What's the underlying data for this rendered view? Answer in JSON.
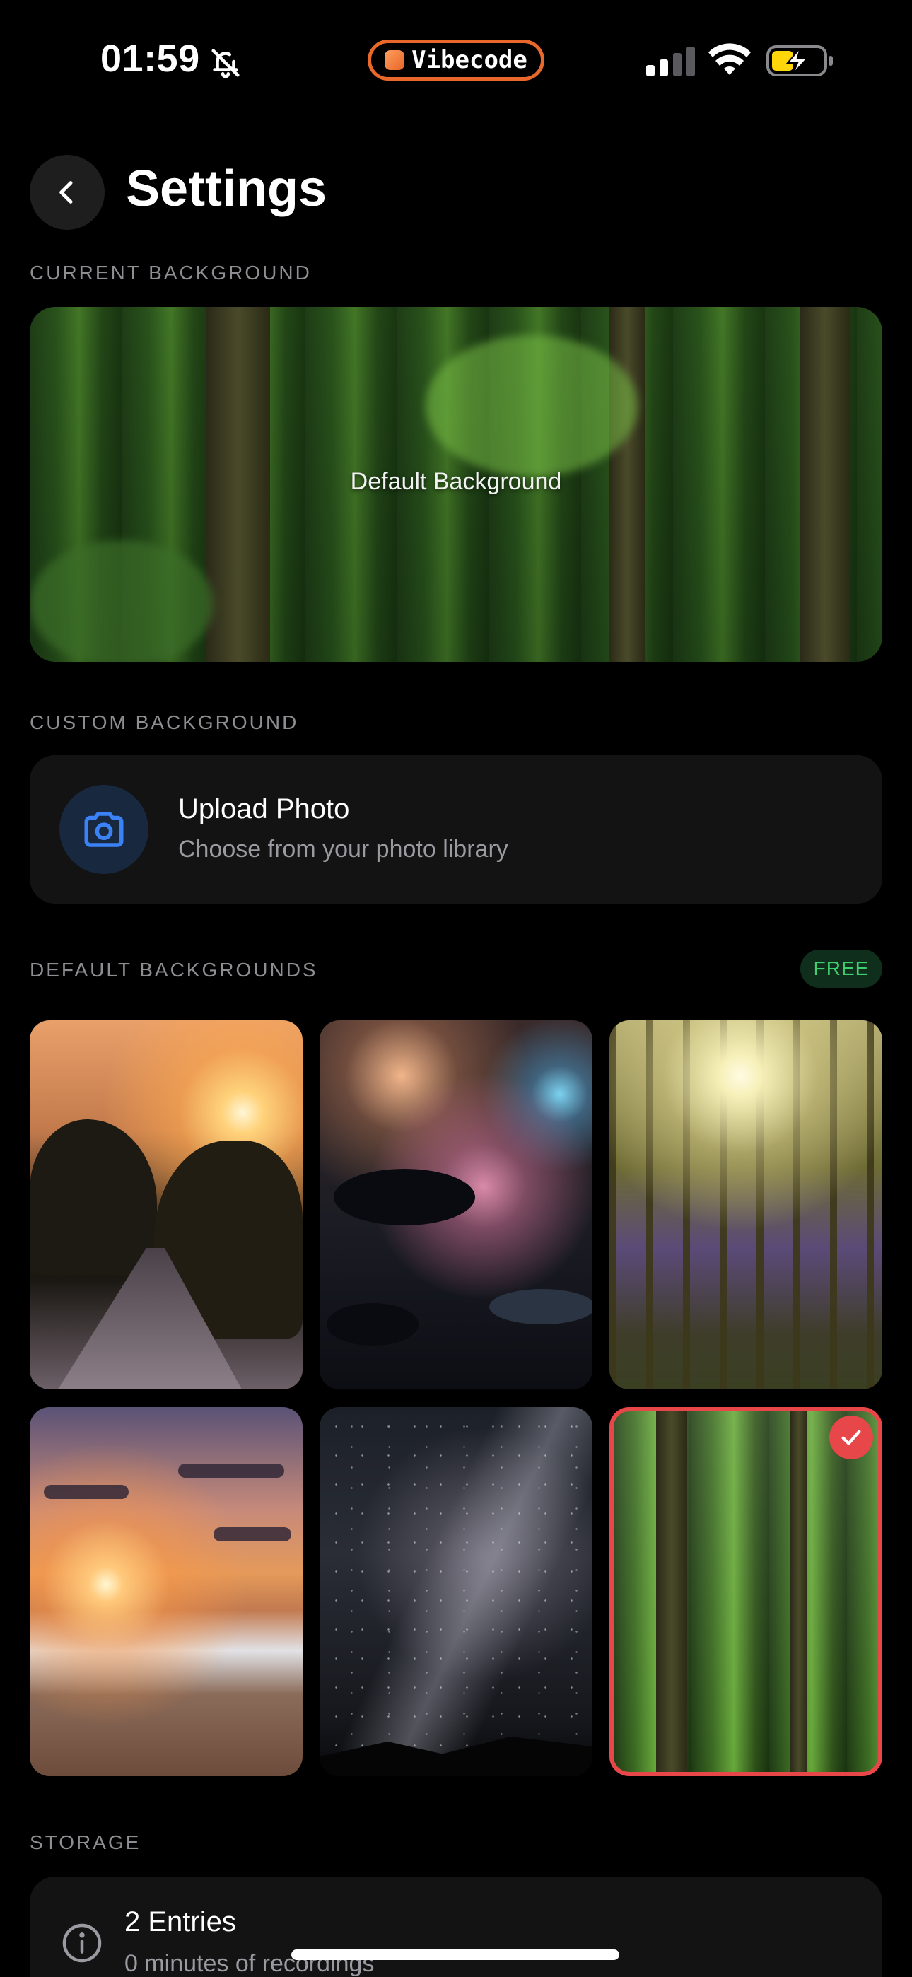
{
  "status_bar": {
    "time": "01:59",
    "app_pill": "Vibecode",
    "icons": [
      "bell-slash-icon",
      "cellular-signal-icon",
      "wifi-icon",
      "battery-charging-icon"
    ]
  },
  "header": {
    "title": "Settings"
  },
  "current_background": {
    "section_label": "CURRENT BACKGROUND",
    "label": "Default Background"
  },
  "custom_background": {
    "section_label": "CUSTOM BACKGROUND",
    "upload_title": "Upload Photo",
    "upload_subtitle": "Choose from your photo library"
  },
  "default_backgrounds": {
    "section_label": "DEFAULT BACKGROUNDS",
    "badge": "FREE",
    "items": [
      {
        "name": "sunset-road",
        "selected": false
      },
      {
        "name": "bokeh-lights",
        "selected": false
      },
      {
        "name": "bluebell-forest",
        "selected": false
      },
      {
        "name": "beach-sunset",
        "selected": false
      },
      {
        "name": "milky-way",
        "selected": false
      },
      {
        "name": "rainforest",
        "selected": true
      }
    ]
  },
  "storage": {
    "section_label": "STORAGE",
    "entries": "2 Entries",
    "subtitle": "0 minutes of recordings"
  },
  "colors": {
    "accent_orange": "#e8672a",
    "selected_red": "#e8474a",
    "upload_blue": "#3b82f6",
    "free_green": "#3fcf6f"
  }
}
